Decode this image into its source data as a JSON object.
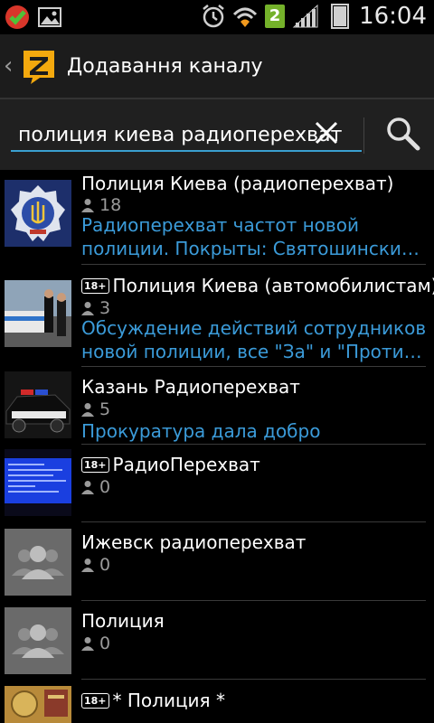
{
  "status_bar": {
    "time": "16:04",
    "notification_count": "2",
    "icons": [
      "check-shield-icon",
      "image-icon",
      "alarm-icon",
      "wifi-icon",
      "signal-icon",
      "battery-icon"
    ]
  },
  "action_bar": {
    "title": "Додавання каналу",
    "icons": [
      "back-chevron-icon",
      "zello-logo-icon"
    ]
  },
  "search": {
    "value": "полиция киева радиоперехват"
  },
  "channels": [
    {
      "title": "Полиция Киева (радиоперехват)",
      "adult": false,
      "users": "18",
      "desc_line1": "Радиоперехват частот новой",
      "desc_line2": "полиции. Покрыты: Святошинский…",
      "thumb": "police-emblem"
    },
    {
      "title": "Полиция Киева (автомобилистам)",
      "adult": true,
      "adult_label": "18+",
      "users": "3",
      "desc_line1": "Обсуждение действий сотрудников",
      "desc_line2": "новой полиции, все \"За\" и \"Против…",
      "thumb": "police-officers"
    },
    {
      "title": "Казань Радиоперехват",
      "adult": false,
      "users": "5",
      "desc_line1": "Прокуратура дала добро",
      "desc_line2": "",
      "thumb": "police-car"
    },
    {
      "title": "РадиоПерехват",
      "adult": true,
      "adult_label": "18+",
      "users": "0",
      "desc_line1": "",
      "desc_line2": "",
      "thumb": "blue-screen"
    },
    {
      "title": "Ижевск радиоперехват",
      "adult": false,
      "users": "0",
      "thumb": "group-placeholder"
    },
    {
      "title": "Полиция",
      "adult": false,
      "users": "0",
      "thumb": "group-placeholder"
    },
    {
      "title": "* Полиция *",
      "adult": true,
      "adult_label": "18+",
      "users": "",
      "thumb": "badge-photo"
    }
  ],
  "colors": {
    "accent": "#3b9bd9",
    "logo": "#f4a90e",
    "action_bar": "#1c1c1c",
    "secondary_text": "#9a9a9a"
  }
}
